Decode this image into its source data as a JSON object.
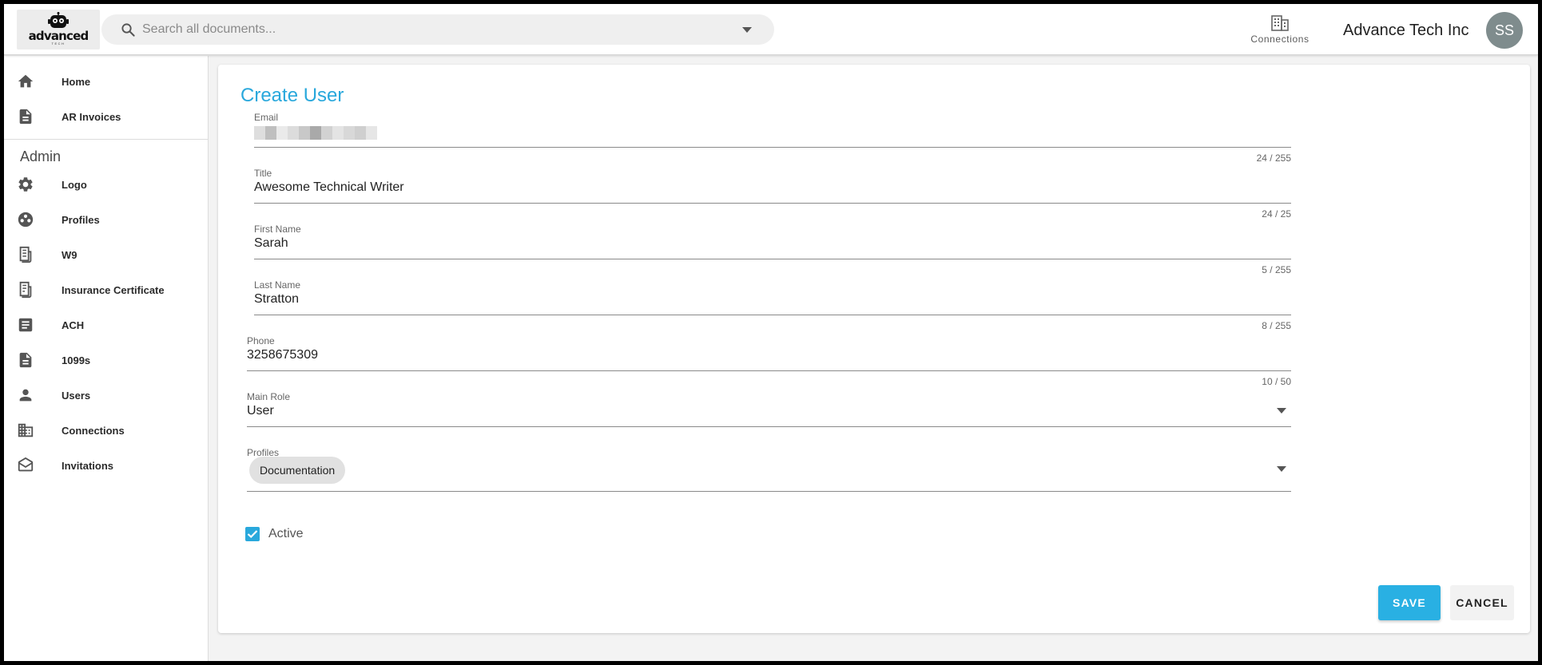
{
  "header": {
    "logo_text": "advanced",
    "logo_subtext": "TECH",
    "search_placeholder": "Search all documents...",
    "connections_label": "Connections",
    "org_name": "Advance Tech Inc",
    "avatar_initials": "SS"
  },
  "sidebar": {
    "top_items": [
      {
        "label": "Home",
        "icon": "home-icon"
      },
      {
        "label": "AR Invoices",
        "icon": "document-icon"
      }
    ],
    "admin_heading": "Admin",
    "admin_items": [
      {
        "label": "Logo",
        "icon": "gear-icon"
      },
      {
        "label": "Profiles",
        "icon": "profiles-icon"
      },
      {
        "label": "W9",
        "icon": "form-icon"
      },
      {
        "label": "Insurance Certificate",
        "icon": "certificate-icon"
      },
      {
        "label": "ACH",
        "icon": "article-icon"
      },
      {
        "label": "1099s",
        "icon": "document-icon"
      },
      {
        "label": "Users",
        "icon": "person-icon"
      },
      {
        "label": "Connections",
        "icon": "building-icon"
      },
      {
        "label": "Invitations",
        "icon": "envelope-open-icon"
      }
    ]
  },
  "form": {
    "title": "Create User",
    "email": {
      "label": "Email",
      "counter": "24 / 255"
    },
    "title_field": {
      "label": "Title",
      "value": "Awesome Technical Writer",
      "counter": "24 / 25"
    },
    "first_name": {
      "label": "First Name",
      "value": "Sarah",
      "counter": "5 / 255"
    },
    "last_name": {
      "label": "Last Name",
      "value": "Stratton",
      "counter": "8 / 255"
    },
    "phone": {
      "label": "Phone",
      "value": "3258675309",
      "counter": "10 / 50"
    },
    "main_role": {
      "label": "Main Role",
      "value": "User"
    },
    "profiles": {
      "label": "Profiles",
      "chips": [
        "Documentation"
      ]
    },
    "active": {
      "label": "Active",
      "checked": true
    },
    "save_label": "SAVE",
    "cancel_label": "CANCEL"
  },
  "colors": {
    "accent": "#29a8dc",
    "save_button": "#29b0e3",
    "avatar": "#7f8c8d"
  }
}
